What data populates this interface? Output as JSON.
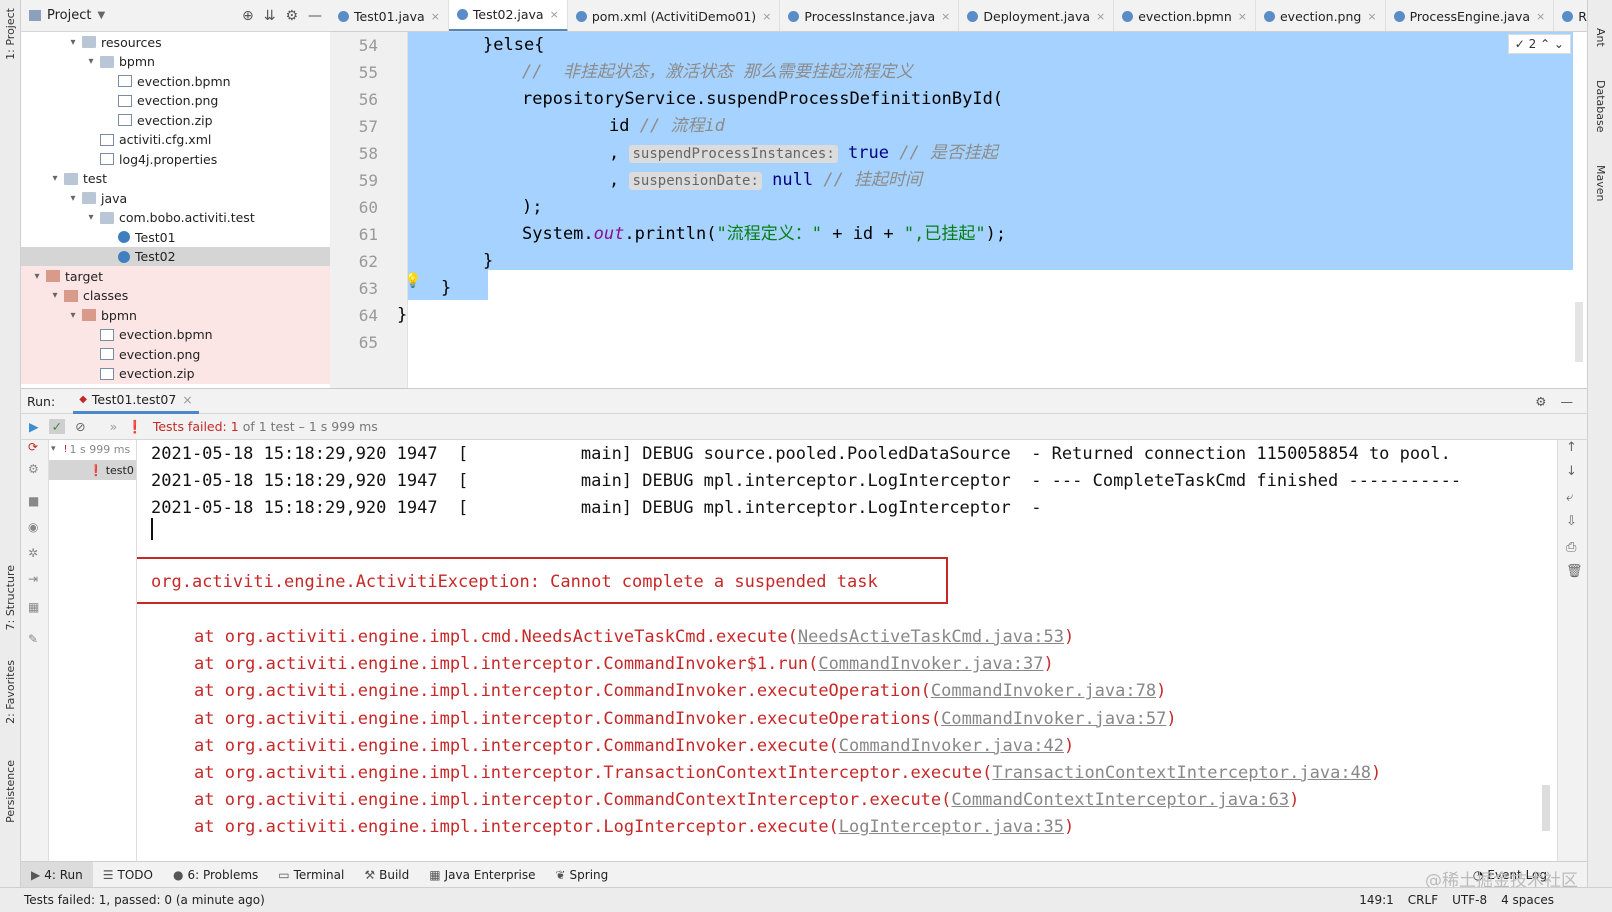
{
  "side_left": {
    "project": "1: Project",
    "structure": "7: Structure",
    "favorites": "2: Favorites",
    "persistence": "Persistence"
  },
  "side_right": {
    "ant": "Ant",
    "database": "Database",
    "maven": "Maven"
  },
  "project_panel": {
    "title": "Project",
    "tree": [
      {
        "label": "resources",
        "depth": 3,
        "arrow": "▾",
        "kind": "folder"
      },
      {
        "label": "bpmn",
        "depth": 4,
        "arrow": "▾",
        "kind": "folder"
      },
      {
        "label": "evection.bpmn",
        "depth": 5,
        "arrow": "",
        "kind": "file"
      },
      {
        "label": "evection.png",
        "depth": 5,
        "arrow": "",
        "kind": "file"
      },
      {
        "label": "evection.zip",
        "depth": 5,
        "arrow": "",
        "kind": "file"
      },
      {
        "label": "activiti.cfg.xml",
        "depth": 4,
        "arrow": "",
        "kind": "file"
      },
      {
        "label": "log4j.properties",
        "depth": 4,
        "arrow": "",
        "kind": "file"
      },
      {
        "label": "test",
        "depth": 2,
        "arrow": "▾",
        "kind": "folder"
      },
      {
        "label": "java",
        "depth": 3,
        "arrow": "▾",
        "kind": "folder"
      },
      {
        "label": "com.bobo.activiti.test",
        "depth": 4,
        "arrow": "▾",
        "kind": "folder"
      },
      {
        "label": "Test01",
        "depth": 5,
        "arrow": "",
        "kind": "java"
      },
      {
        "label": "Test02",
        "depth": 5,
        "arrow": "",
        "kind": "java",
        "selected": true
      },
      {
        "label": "target",
        "depth": 1,
        "arrow": "▾",
        "kind": "folder-red"
      },
      {
        "label": "classes",
        "depth": 2,
        "arrow": "▾",
        "kind": "folder-red"
      },
      {
        "label": "bpmn",
        "depth": 3,
        "arrow": "▾",
        "kind": "folder-red"
      },
      {
        "label": "evection.bpmn",
        "depth": 4,
        "arrow": "",
        "kind": "file"
      },
      {
        "label": "evection.png",
        "depth": 4,
        "arrow": "",
        "kind": "file"
      },
      {
        "label": "evection.zip",
        "depth": 4,
        "arrow": "",
        "kind": "file"
      }
    ]
  },
  "editor_tabs": [
    {
      "label": "Test01.java",
      "active": false
    },
    {
      "label": "Test02.java",
      "active": true
    },
    {
      "label": "pom.xml (ActivitiDemo01)",
      "active": false
    },
    {
      "label": "ProcessInstance.java",
      "active": false
    },
    {
      "label": "Deployment.java",
      "active": false
    },
    {
      "label": "evection.bpmn",
      "active": false
    },
    {
      "label": "evection.png",
      "active": false
    },
    {
      "label": "ProcessEngine.java",
      "active": false
    },
    {
      "label": "Reposi",
      "active": false
    }
  ],
  "editor": {
    "hint_count": "2",
    "line_numbers": [
      "54",
      "55",
      "56",
      "57",
      "58",
      "59",
      "60",
      "61",
      "62",
      "63",
      "64",
      "65"
    ],
    "lines": {
      "l54": "}else{",
      "l55_comment": "//  非挂起状态，激活状态 那么需要挂起流程定义",
      "l56": "repositoryService.suspendProcessDefinitionById(",
      "l57_code": "id ",
      "l57_comment": "// 流程id",
      "l58_comma": ", ",
      "l58_hint": "suspendProcessInstances:",
      "l58_val": " true ",
      "l58_comment": "// 是否挂起",
      "l59_comma": ", ",
      "l59_hint": "suspensionDate:",
      "l59_val": " null ",
      "l59_comment": "// 挂起时间",
      "l60": ");",
      "l61_a": "System.",
      "l61_out": "out",
      "l61_b": ".println(",
      "l61_str1": "\"流程定义：\"",
      "l61_c": " + id + ",
      "l61_str2": "\",已挂起\"",
      "l61_d": ");",
      "l62": "}",
      "l63": "}",
      "l64": "}"
    }
  },
  "run_panel": {
    "label": "Run:",
    "tab": "Test01.test07",
    "status_failed": "Tests failed:",
    "status_count": "1",
    "status_rest": "of 1 test – 1 s 999 ms",
    "tree_time": "1 s 999 ms",
    "tree_item": "test0"
  },
  "console": {
    "log_lines": [
      "2021-05-18 15:18:29,920 1947  [           main] DEBUG source.pooled.PooledDataSource  - Returned connection 1150058854 to pool.",
      "2021-05-18 15:18:29,920 1947  [           main] DEBUG mpl.interceptor.LogInterceptor  - --- CompleteTaskCmd finished -----------",
      "2021-05-18 15:18:29,920 1947  [           main] DEBUG mpl.interceptor.LogInterceptor  -"
    ],
    "exception": "org.activiti.engine.ActivitiException: Cannot complete a suspended task",
    "stack": [
      {
        "text": "at org.activiti.engine.impl.cmd.NeedsActiveTaskCmd.execute(",
        "link": "NeedsActiveTaskCmd.java:53",
        "end": ")"
      },
      {
        "text": "at org.activiti.engine.impl.interceptor.CommandInvoker$1.run(",
        "link": "CommandInvoker.java:37",
        "end": ")"
      },
      {
        "text": "at org.activiti.engine.impl.interceptor.CommandInvoker.executeOperation(",
        "link": "CommandInvoker.java:78",
        "end": ")"
      },
      {
        "text": "at org.activiti.engine.impl.interceptor.CommandInvoker.executeOperations(",
        "link": "CommandInvoker.java:57",
        "end": ")"
      },
      {
        "text": "at org.activiti.engine.impl.interceptor.CommandInvoker.execute(",
        "link": "CommandInvoker.java:42",
        "end": ")"
      },
      {
        "text": "at org.activiti.engine.impl.interceptor.TransactionContextInterceptor.execute(",
        "link": "TransactionContextInterceptor.java:48",
        "end": ")"
      },
      {
        "text": "at org.activiti.engine.impl.interceptor.CommandContextInterceptor.execute(",
        "link": "CommandContextInterceptor.java:63",
        "end": ")"
      },
      {
        "text": "at org.activiti.engine.impl.interceptor.LogInterceptor.execute(",
        "link": "LogInterceptor.java:35",
        "end": ")"
      }
    ]
  },
  "bottom_tabs": [
    {
      "label": "4: Run",
      "icon": "▶",
      "active": true
    },
    {
      "label": "TODO",
      "icon": "☰",
      "active": false
    },
    {
      "label": "6: Problems",
      "icon": "●",
      "active": false
    },
    {
      "label": "Terminal",
      "icon": "▭",
      "active": false
    },
    {
      "label": "Build",
      "icon": "⚒",
      "active": false
    },
    {
      "label": "Java Enterprise",
      "icon": "▦",
      "active": false
    },
    {
      "label": "Spring",
      "icon": "❦",
      "active": false
    }
  ],
  "event_log": "Event Log",
  "watermark": "@稀土掘金技术社区",
  "status_bar": {
    "message": "Tests failed: 1, passed: 0 (a minute ago)",
    "position": "149:1",
    "line_sep": "CRLF",
    "encoding": "UTF-8",
    "indent": "4 spaces"
  },
  "colors": {
    "selection": "#a6d2ff",
    "error": "#c62828",
    "accent": "#4a88c7"
  }
}
